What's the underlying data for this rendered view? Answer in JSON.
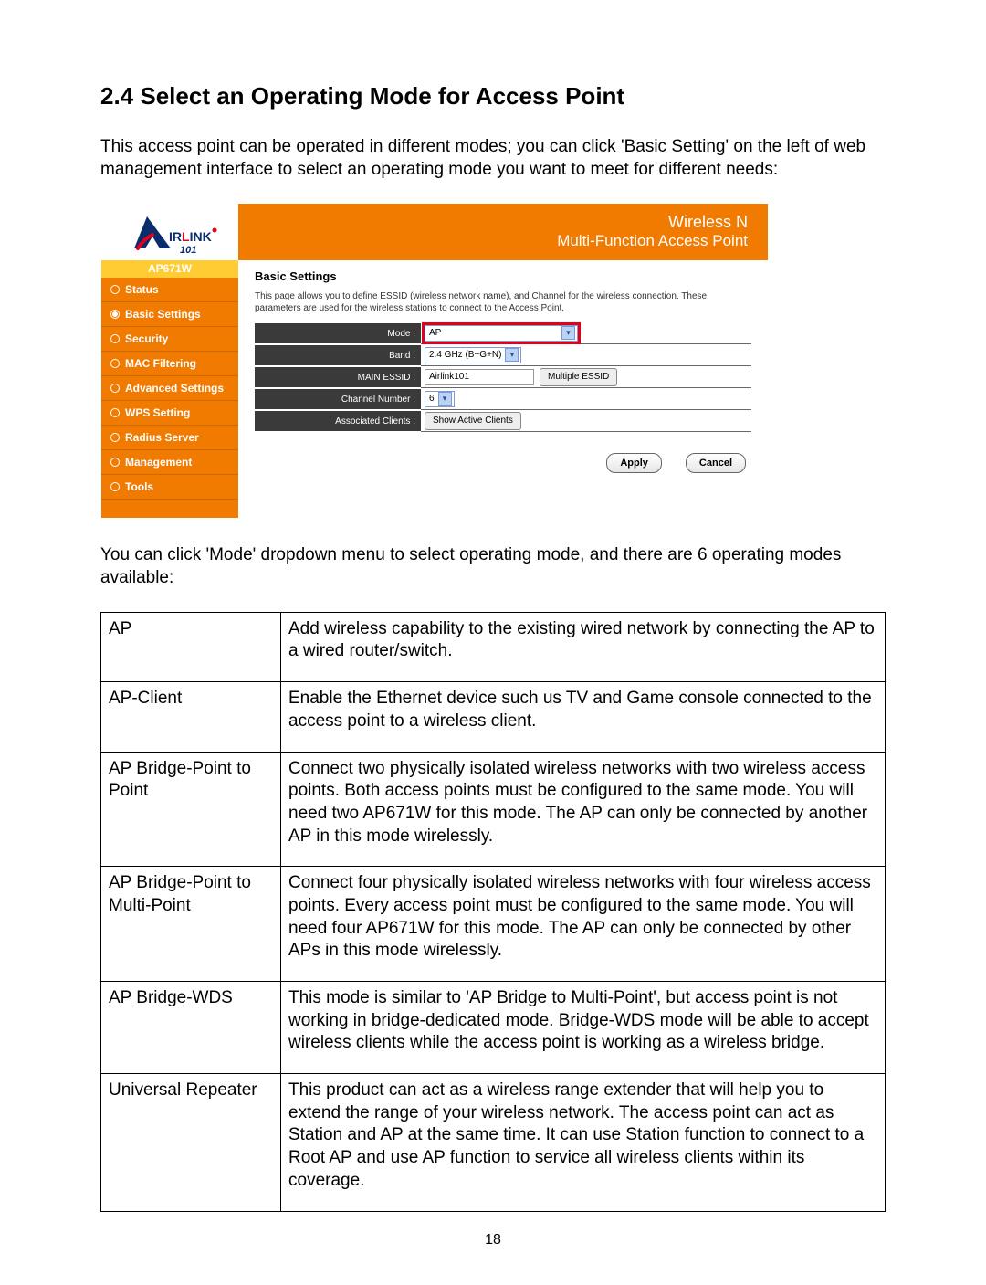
{
  "heading": "2.4 Select an Operating Mode for Access Point",
  "intro": "This access point can be operated in different modes; you can click 'Basic Setting' on the left of web management interface to select an operating mode you want to meet for different needs:",
  "router": {
    "banner_line1": "Wireless N",
    "banner_line2": "Multi-Function Access Point",
    "model": "AP671W",
    "nav": [
      "Status",
      "Basic Settings",
      "Security",
      "MAC Filtering",
      "Advanced Settings",
      "WPS Setting",
      "Radius Server",
      "Management",
      "Tools"
    ],
    "nav_active_index": 1,
    "main_title": "Basic Settings",
    "main_desc": "This page allows you to define ESSID (wireless network name), and Channel for the wireless connection. These parameters are used for the wireless stations to connect to the Access Point.",
    "rows": {
      "mode": {
        "label": "Mode :",
        "value": "AP"
      },
      "band": {
        "label": "Band :",
        "value": "2.4 GHz (B+G+N)"
      },
      "essid": {
        "label": "MAIN ESSID :",
        "value": "Airlink101",
        "button": "Multiple ESSID"
      },
      "channel": {
        "label": "Channel Number :",
        "value": "6"
      },
      "clients": {
        "label": "Associated Clients :",
        "button": "Show Active Clients"
      }
    },
    "apply": "Apply",
    "cancel": "Cancel"
  },
  "after_para": "You can click 'Mode' dropdown menu to select operating mode, and there are 6 operating modes available:",
  "modes": [
    {
      "name": "AP",
      "desc": "Add wireless capability to the existing wired network by connecting the AP to a wired router/switch."
    },
    {
      "name": "AP-Client",
      "desc": "Enable the Ethernet device such us TV and Game console connected to the access point to a wireless client."
    },
    {
      "name": "AP Bridge-Point to Point",
      "desc": "Connect two physically isolated wireless networks with two wireless access points. Both access points must be configured to the same mode. You will need two AP671W for this mode. The AP can only be connected by another AP in this mode wirelessly."
    },
    {
      "name": "AP Bridge-Point to Multi-Point",
      "desc": "Connect four physically isolated wireless networks with four wireless access points. Every access point must be configured to the same mode. You will need four AP671W for this mode. The AP can only be connected by other APs in this mode wirelessly."
    },
    {
      "name": "AP Bridge-WDS",
      "desc": "This mode is similar to 'AP Bridge to Multi-Point', but access point is not working in bridge-dedicated mode. Bridge-WDS mode will be able to accept wireless clients while the access point is working as a wireless bridge."
    },
    {
      "name": "Universal Repeater",
      "desc": "This product can act as a wireless range extender that will help you to extend the range of your wireless network. The access point can act as Station and AP at the same time. It can use Station function to connect to a Root AP and use AP function to service all wireless clients within its coverage."
    }
  ],
  "page_number": "18"
}
